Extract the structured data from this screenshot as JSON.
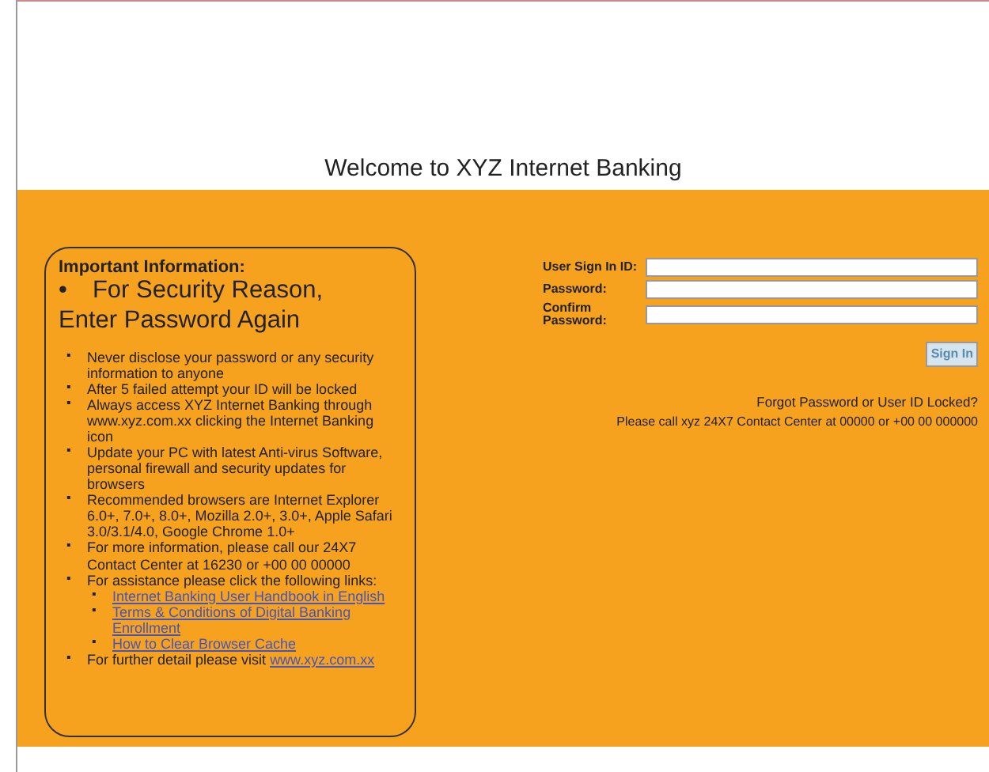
{
  "header": {
    "title": "Welcome to XYZ Internet Banking"
  },
  "info": {
    "heading": "Important Information:",
    "alert_marker": "•",
    "alert": "For Security Reason, Enter Password Again",
    "marker": "▪",
    "items": [
      {
        "text": "Never disclose your password or any security information to anyone"
      },
      {
        "text": "After 5 failed attempt your ID will be locked"
      },
      {
        "text": "Always access XYZ Internet Banking through www.xyz.com.xx clicking the Internet Banking icon"
      },
      {
        "text": "Update your PC with latest Anti-virus Software, personal firewall and security updates for browsers"
      },
      {
        "text": "Recommended browsers are Internet Explorer 6.0+, 7.0+, 8.0+, Mozilla 2.0+, 3.0+, Apple Safari 3.0/3.1/4.0, Google Chrome 1.0+"
      },
      {
        "text": "For more information, please call our 24X7 Contact Center at 16230 or +00 00 00000"
      },
      {
        "text": "For assistance please click the following links:",
        "links": [
          "Internet Banking User Handbook in English",
          "Terms & Conditions of Digital Banking Enrollment",
          "How to Clear Browser Cache"
        ]
      },
      {
        "text": "For further detail please visit",
        "link": "www.xyz.com.xx"
      }
    ]
  },
  "form": {
    "fields": [
      {
        "label": "User Sign In ID:"
      },
      {
        "label": "Password:"
      },
      {
        "label": "Confirm Password:"
      }
    ],
    "button": "Sign In",
    "forgot": "Forgot Password or User ID Locked?",
    "call": "Please call xyz 24X7 Contact Center at 00000 or +00 00 000000"
  }
}
